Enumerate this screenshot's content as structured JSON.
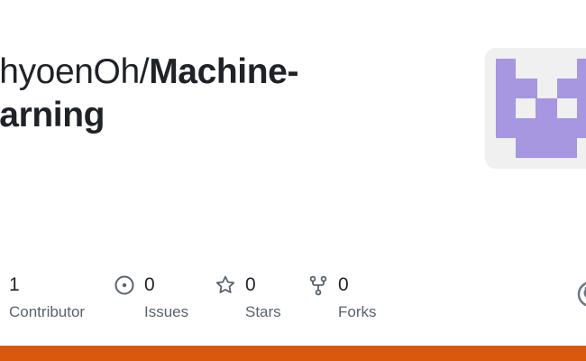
{
  "repo": {
    "owner_prefix": "uhyoenOh/",
    "name_line1": "Machine-",
    "name_line2": "earning"
  },
  "stats": [
    {
      "value": "1",
      "label": "Contributor",
      "icon": "contributors-icon"
    },
    {
      "value": "0",
      "label": "Issues",
      "icon": "issue-icon"
    },
    {
      "value": "0",
      "label": "Stars",
      "icon": "star-icon"
    },
    {
      "value": "0",
      "label": "Forks",
      "icon": "fork-icon"
    }
  ],
  "colors": {
    "text_primary": "#1f2328",
    "text_muted": "#59636e",
    "avatar_bg": "#f0f0f0",
    "avatar_fg": "#a796e0",
    "icon": "#59636e",
    "accent_bar": "#d9580d"
  }
}
